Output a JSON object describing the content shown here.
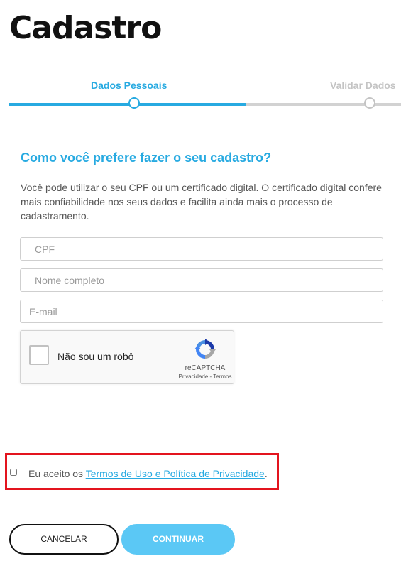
{
  "header": {
    "title": "Cadastro"
  },
  "stepper": {
    "steps": [
      {
        "label": "Dados Pessoais",
        "state": "active"
      },
      {
        "label": "Validar Dados",
        "state": "inactive"
      }
    ],
    "colors": {
      "active": "#27aae1",
      "inactive": "#c4c4c4"
    }
  },
  "form": {
    "heading": "Como você prefere fazer o seu cadastro?",
    "intro": "Você pode utilizar o seu CPF ou um certificado digital. O certificado digital confere mais confiabilidade nos seus dados e facilita ainda mais o processo de cadastramento.",
    "fields": {
      "cpf": {
        "placeholder": "CPF",
        "value": ""
      },
      "name": {
        "placeholder": "Nome completo",
        "value": ""
      },
      "email": {
        "placeholder": "E-mail",
        "value": ""
      }
    }
  },
  "captcha": {
    "label": "Não sou um robô",
    "brand": "reCAPTCHA",
    "links": "Privacidade - Termos",
    "icon": "recaptcha-icon"
  },
  "terms": {
    "prefix": "Eu aceito os ",
    "link": "Termos de Uso e Política de Privacidade",
    "suffix": ".",
    "checked": false
  },
  "actions": {
    "cancel": "CANCELAR",
    "continue": "CONTINUAR"
  }
}
